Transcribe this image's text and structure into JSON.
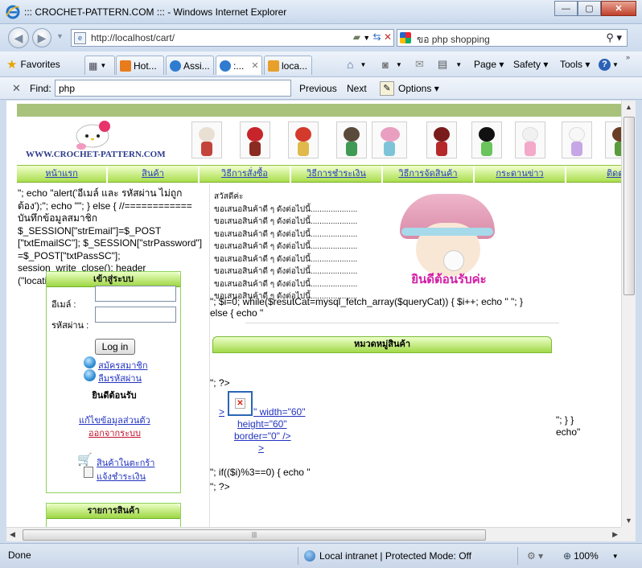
{
  "window": {
    "title": "::: CROCHET-PATTERN.COM ::: - Windows Internet Explorer",
    "minimize": "—",
    "maximize": "▢",
    "close": "✕"
  },
  "address_bar": {
    "url": "http://localhost/cart/"
  },
  "search_box": {
    "text": "ขอ php shopping"
  },
  "favorites_bar": {
    "favorites_label": "Favorites",
    "tabs": [
      {
        "label": "Hot...",
        "icon": "hotmail-icon",
        "color": "#e87b1c"
      },
      {
        "label": "Assi...",
        "icon": "ie-page-icon",
        "color": "#2f7bd0"
      },
      {
        "label": ":...",
        "icon": "ie-page-icon",
        "color": "#2f7bd0"
      },
      {
        "label": "loca...",
        "icon": "phpmyadmin-icon",
        "color": "#e7a02b"
      }
    ],
    "active_tab_close": "✕",
    "commands": [
      "Page ▾",
      "Safety ▾",
      "Tools ▾"
    ]
  },
  "find_bar": {
    "label": "Find:",
    "value": "php",
    "previous": "Previous",
    "next": "Next",
    "options": "Options ▾"
  },
  "site": {
    "logo_url": "WWW.CROCHET-PATTERN.COM",
    "menu": [
      "หน้าแรก",
      "สินค้า",
      "วิธีการสั่งซื้อ",
      "วิธีการชำระเงิน",
      "วิธีการจัดสินค้า",
      "กระดานข่าว",
      "ติดต่อเรา"
    ],
    "raw_php_left": "\"; echo \"alert('อีเมล์ และ รหัสผ่าน ไม่ถูกต้อง');\"; echo \"\"; } else { //============ บันทึกข้อมูลสมาชิก $_SESSION[\"strEmail\"]=$_POST [\"txtEmailSC\"]; $_SESSION[\"strPassword\"] =$_POST[\"txtPassSC\"]; session_write_close(); header (\"location:cart.php\"); } } ?>",
    "login_box": {
      "header": "เข้าสู่ระบบ",
      "email_label": "อีเมล์ :",
      "password_label": "รหัสผ่าน :",
      "button": "Log in",
      "register_link": "สมัครสมาชิก",
      "forgot_link": "ลืมรหัสผ่าน",
      "welcome": "ยินดีต้อนรับ",
      "edit_profile_link": "แก้ไขข้อมูลส่วนตัว",
      "logout_link": "ออกจากระบบ",
      "cart_link": "สินค้าในตะกร้า",
      "payment_link": "แจ้งชำระเงิน"
    },
    "product_list_header": "รายการสินค้า",
    "greeting": "สวัสดีค่ะ",
    "offer_lines": [
      "ขอเสนอสินค้าดี ๆ ดังต่อไปนี้.....................",
      "ขอเสนอสินค้าดี ๆ ดังต่อไปนี้.....................",
      "ขอเสนอสินค้าดี ๆ ดังต่อไปนี้.....................",
      "ขอเสนอสินค้าดี ๆ ดังต่อไปนี้.....................",
      "ขอเสนอสินค้าดี ๆ ดังต่อไปนี้.....................",
      "ขอเสนอสินค้าดี ๆ ดังต่อไปนี้.....................",
      "ขอเสนอสินค้าดี ๆ ดังต่อไปนี้.....................",
      "ขอเสนอสินค้าดี ๆ ดังต่อไปนี้....................."
    ],
    "welcome_banner": "ยินดีต้อนรับค่ะ",
    "raw_php_right": "\"; $i=0; while($resutCat=mysql_fetch_array($queryCat)) { $i++; echo \" \"; } else { echo \"",
    "category_header": "หมวดหมู่สินค้า",
    "text_close_php": "\"; ?>",
    "img_fragment_1": ">",
    "img_fragment_2": "\" width=\"60\"",
    "img_fragment_3": "height=\"60\"",
    "img_fragment_4": "border=\"0\" />",
    "img_fragment_5": ">",
    "text_right_a": "\"; } }",
    "text_right_b": "echo\"",
    "text_if_mod": "\"; if(($i)%3==0) { echo \"",
    "text_close_php_2": "\"; ?>"
  },
  "status_bar": {
    "status": "Done",
    "zone": "Local intranet | Protected Mode: Off",
    "zoom": "100%"
  },
  "colors": {
    "accent_green": "#a9de4d",
    "stripe": "#a8c27c",
    "link_blue": "#2233c0",
    "logout_red": "#c0102a",
    "banner_pink": "#d41da6"
  }
}
